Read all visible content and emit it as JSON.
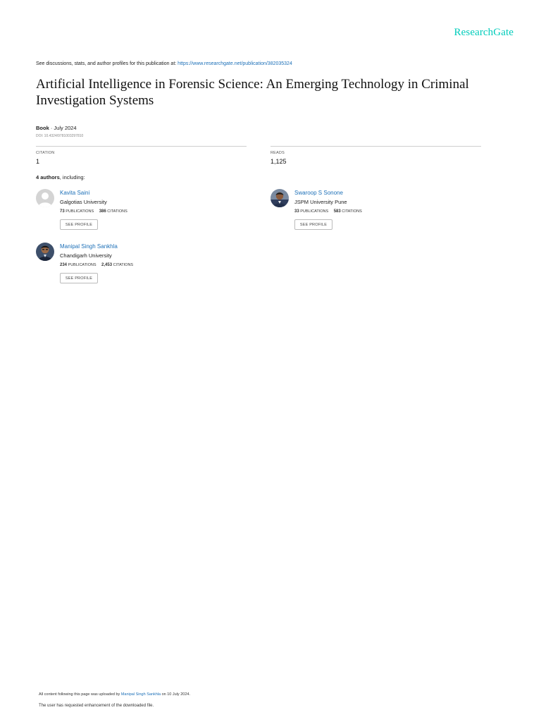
{
  "header": {
    "logo": "ResearchGate",
    "see_prefix": "See discussions, stats, and author profiles for this publication at: ",
    "see_link": "https://www.researchgate.net/publication/382035324"
  },
  "publication": {
    "title": "Artificial Intelligence in Forensic Science: An Emerging Technology in Criminal Investigation Systems",
    "type": "Book",
    "date": " · July 2024",
    "doi": "DOI: 10.4324/9781003297810"
  },
  "stats": {
    "citation_label": "CITATION",
    "citation_value": "1",
    "reads_label": "READS",
    "reads_value": "1,125"
  },
  "authors_summary": {
    "count": "4 authors",
    "suffix": ", including:"
  },
  "authors": [
    {
      "name": "Kavita Saini",
      "institution": "Galgotias University",
      "publications": "73",
      "publications_label": "PUBLICATIONS",
      "citations": "386",
      "citations_label": "CITATIONS",
      "button": "SEE PROFILE"
    },
    {
      "name": "Swaroop S Sonone",
      "institution": "JSPM University Pune",
      "publications": "33",
      "publications_label": "PUBLICATIONS",
      "citations": "583",
      "citations_label": "CITATIONS",
      "button": "SEE PROFILE"
    },
    {
      "name": "Manipal Singh Sankhla",
      "institution": "Chandigarh University",
      "publications": "234",
      "publications_label": "PUBLICATIONS",
      "citations": "2,453",
      "citations_label": "CITATIONS",
      "button": "SEE PROFILE"
    }
  ],
  "footer": {
    "uploaded_prefix": "All content following this page was uploaded by ",
    "uploaded_by": "Manipal Singh Sankhla",
    "uploaded_suffix": " on 10 July 2024.",
    "note": "The user has requested enhancement of the downloaded file."
  },
  "colors": {
    "brand": "#00ccbb",
    "link": "#1d70b8"
  }
}
